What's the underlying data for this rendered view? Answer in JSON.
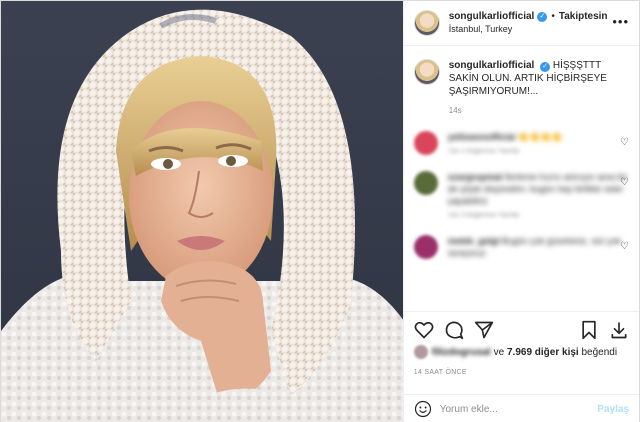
{
  "post": {
    "username": "songulkarliofficial",
    "verified_mark": "✓",
    "separator": "•",
    "follow_label": "Takiptesin",
    "location": "İstanbul, Turkey",
    "more_icon": "more-options-icon",
    "caption": "HİŞŞŞTTT SAKİN OLUN. ARTIK HİÇBİRŞEYE ŞAŞIRMIYORUM!...",
    "caption_time": "14s"
  },
  "comments": [
    {
      "user": "yellowonofficial",
      "text": "👏👏👏👏",
      "meta": "13s 1 beğenme Yanıtla",
      "avatar_color": "#d9465b"
    },
    {
      "user": "ozargrupmat",
      "text": "İlerleme hızını artırıyor ama bir de şöyle düşünelim: bugün hep birlikte neler yapabiliriz",
      "meta": "14s 3 beğenme Yanıtla",
      "avatar_color": "#5a6b3a"
    },
    {
      "user": "melek_gelgl",
      "text": "Bugün çok güzelsiniz, sizi çok seviyoruz",
      "meta": "",
      "avatar_color": "#9b2f6a"
    }
  ],
  "likes": {
    "liker": "filizdogrusal",
    "connector": "ve",
    "count_text": "7.969 diğer kişi",
    "suffix": "beğendi"
  },
  "time_ago": "14 SAAT ÖNCE",
  "add_comment": {
    "placeholder": "Yorum ekle...",
    "share_label": "Paylaş"
  },
  "colors": {
    "accent": "#3897f0",
    "share_disabled": "#b2dffc",
    "muted": "#8e8e8e"
  }
}
